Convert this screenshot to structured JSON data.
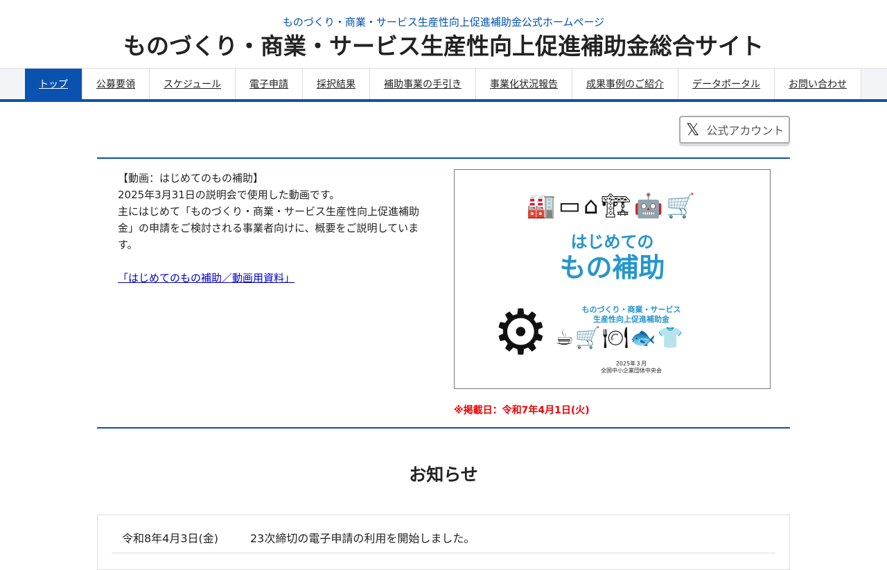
{
  "header": {
    "subtitle": "ものづくり・商業・サービス生産性向上促進補助金公式ホームページ",
    "title": "ものづくり・商業・サービス生産性向上促進補助金総合サイト"
  },
  "nav": [
    "トップ",
    "公募要領",
    "スケジュール",
    "電子申請",
    "採択結果",
    "補助事業の手引き",
    "事業化状況報告",
    "成果事例のご紹介",
    "データポータル",
    "お問い合わせ"
  ],
  "x_button": {
    "icon": "x-logo-icon",
    "label": "公式アカウント"
  },
  "feature": {
    "heading": "【動画：はじめてのもの補助】",
    "lines": [
      "2025年3月31日の説明会で使用した動画です。",
      "主にはじめて「ものづくり・商業・サービス生産性向上促進補助金」の申請をご検討される事業者向けに、概要をご説明しています。"
    ],
    "link": "「はじめてのもの補助／動画用資料」",
    "thumb": {
      "title1": "はじめての",
      "title2": "もの補助",
      "sub1": "ものづくり・商業・サービス",
      "sub2": "生産性向上促進補助金",
      "date": "2025年３月",
      "org": "全国中小企業団体中央会"
    },
    "posted": "※掲載日：令和7年4月1日(火)"
  },
  "news": {
    "heading": "お知らせ",
    "items": [
      {
        "date": "令和8年4月3日(金)",
        "text": "23次締切の電子申請の利用を開始しました。"
      }
    ]
  }
}
